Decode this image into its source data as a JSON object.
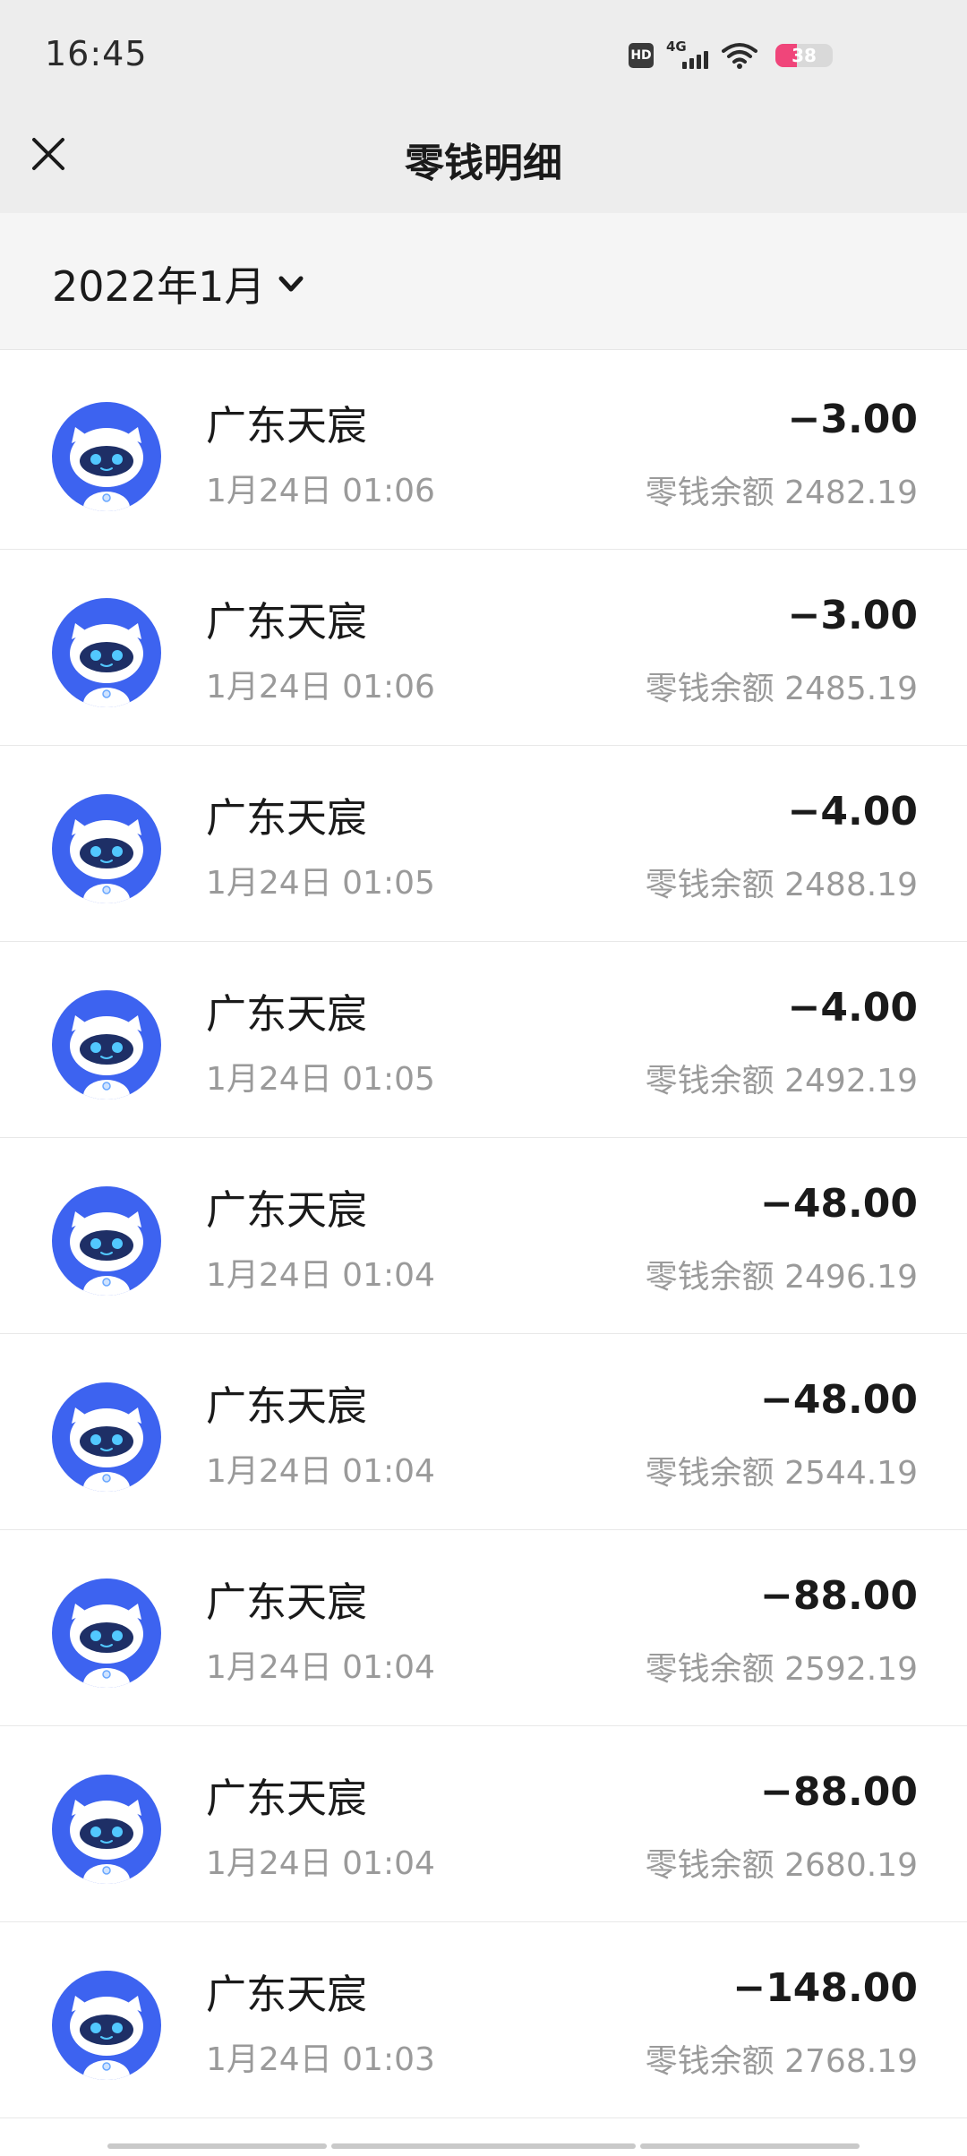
{
  "status_bar": {
    "time": "16:45",
    "hd_label": "HD",
    "network_label": "4G",
    "battery_level": "38",
    "battery_color": "#f0457a"
  },
  "header": {
    "close_icon": "close-icon",
    "title": "零钱明细"
  },
  "filter": {
    "month": "2022年1月",
    "dropdown_icon": "chevron-down-icon"
  },
  "transactions": [
    {
      "merchant": "广东天宸",
      "time": "1月24日 01:06",
      "amount": "−3.00",
      "balance": "零钱余额 2482.19"
    },
    {
      "merchant": "广东天宸",
      "time": "1月24日 01:06",
      "amount": "−3.00",
      "balance": "零钱余额 2485.19"
    },
    {
      "merchant": "广东天宸",
      "time": "1月24日 01:05",
      "amount": "−4.00",
      "balance": "零钱余额 2488.19"
    },
    {
      "merchant": "广东天宸",
      "time": "1月24日 01:05",
      "amount": "−4.00",
      "balance": "零钱余额 2492.19"
    },
    {
      "merchant": "广东天宸",
      "time": "1月24日 01:04",
      "amount": "−48.00",
      "balance": "零钱余额 2496.19"
    },
    {
      "merchant": "广东天宸",
      "time": "1月24日 01:04",
      "amount": "−48.00",
      "balance": "零钱余额 2544.19"
    },
    {
      "merchant": "广东天宸",
      "time": "1月24日 01:04",
      "amount": "−88.00",
      "balance": "零钱余额 2592.19"
    },
    {
      "merchant": "广东天宸",
      "time": "1月24日 01:04",
      "amount": "−88.00",
      "balance": "零钱余额 2680.19"
    },
    {
      "merchant": "广东天宸",
      "time": "1月24日 01:03",
      "amount": "−148.00",
      "balance": "零钱余额 2768.19"
    }
  ],
  "colors": {
    "avatar_blue": "#3d63f0",
    "header_bg": "#ededed",
    "secondary_text": "#9a9a9a"
  }
}
